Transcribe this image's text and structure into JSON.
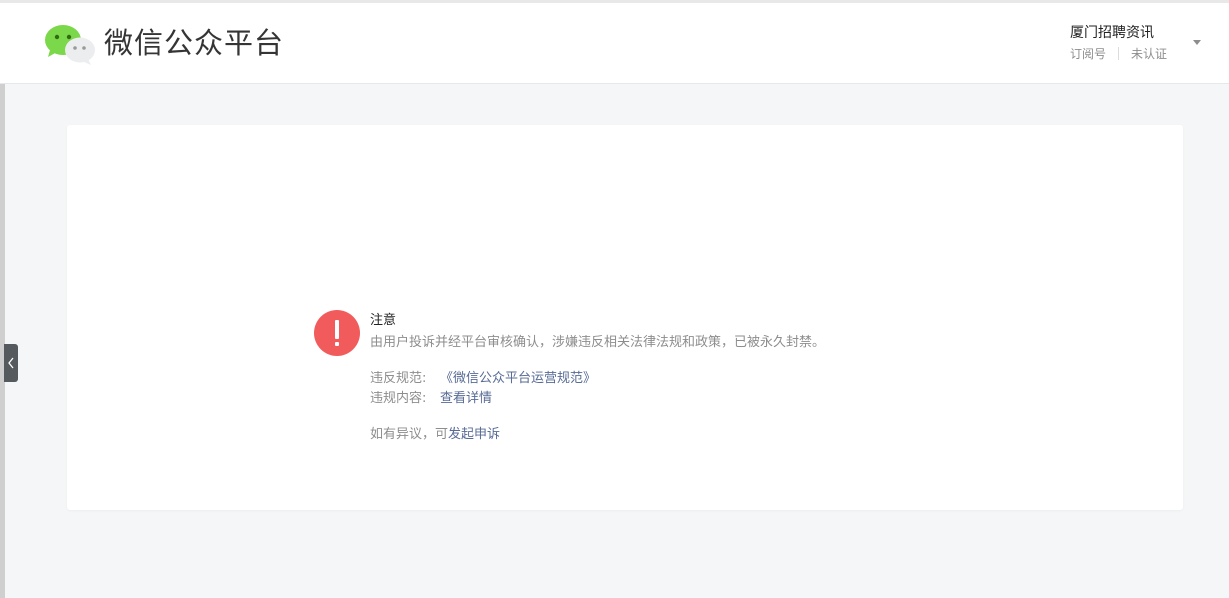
{
  "header": {
    "brand_title": "微信公众平台",
    "account": {
      "name": "厦门招聘资讯",
      "type": "订阅号",
      "verification": "未认证"
    }
  },
  "notice": {
    "title": "注意",
    "description": "由用户投诉并经平台审核确认，涉嫌违反相关法律法规和政策，已被永久封禁。",
    "rule_label": "违反规范:",
    "rule_link": "《微信公众平台运营规范》",
    "content_label": "违规内容:",
    "content_link": "查看详情",
    "appeal_prefix": "如有异议，可",
    "appeal_link": "发起申诉"
  },
  "icons": {
    "logo": "wechat-logo-icon",
    "warning": "exclamation-icon",
    "dropdown": "chevron-down-icon",
    "side_toggle": "chevron-left-icon"
  },
  "colors": {
    "brand_green": "#7bd84a",
    "warning_red": "#f25b5b",
    "link": "#576b95"
  }
}
